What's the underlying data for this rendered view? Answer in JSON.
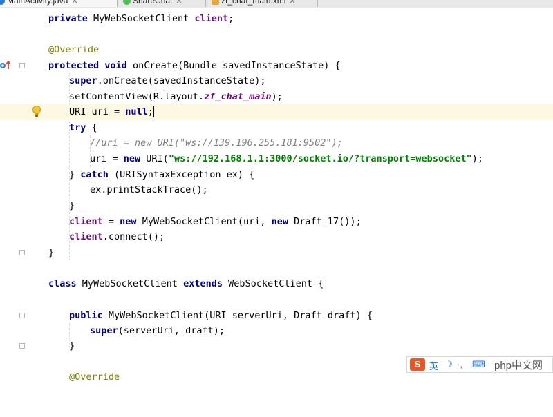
{
  "tabs": [
    {
      "label": "MainActivity.java",
      "active": true,
      "icon_color": "#2f7fc7"
    },
    {
      "label": "ShareChat",
      "active": false,
      "icon_color": "#5cb85c"
    },
    {
      "label": "zf_chat_main.xml",
      "active": false,
      "icon_color": "#e2a83b"
    }
  ],
  "code": {
    "l1": {
      "kw": "private",
      "type": " MyWebSocketClient ",
      "fld": "client",
      "end": ";"
    },
    "l3": {
      "ann": "@Override"
    },
    "l4": {
      "kw1": "protected",
      "kw2": "void",
      "rest": " onCreate(Bundle savedInstanceState) {"
    },
    "l5": {
      "kw": "super",
      "rest": ".onCreate(savedInstanceState);"
    },
    "l6": {
      "pre": "setContentView(R.layout.",
      "ital": "zf_chat_main",
      "end": ");"
    },
    "l7": {
      "pre": "URI uri = ",
      "kw": "null",
      "end": ";"
    },
    "l8": {
      "kw": "try",
      "rest": " {"
    },
    "l9": {
      "cmt": "//uri = new URI(\"ws://139.196.255.181:9502\");"
    },
    "l10": {
      "pre": "uri = ",
      "kw": "new",
      "mid": " URI(",
      "str": "\"ws://192.168.1.1:3000/socket.io/?transport=websocket\"",
      "end": ");"
    },
    "l11": {
      "pre": "} ",
      "kw": "catch",
      "rest": " (URISyntaxException ex) {"
    },
    "l12": {
      "text": "ex.printStackTrace();"
    },
    "l13": {
      "text": "}"
    },
    "l14": {
      "fld": "client",
      "pre": " = ",
      "kw1": "new",
      "mid": " MyWebSocketClient(uri, ",
      "kw2": "new",
      "end": " Draft_17());"
    },
    "l15": {
      "fld": "client",
      "end": ".connect();"
    },
    "l16": {
      "text": "}"
    },
    "l18": {
      "kw1": "class",
      "mid": " MyWebSocketClient ",
      "kw2": "extends",
      "end": " WebSocketClient {"
    },
    "l20": {
      "kw": "public",
      "rest": " MyWebSocketClient(URI serverUri, Draft draft) {"
    },
    "l21": {
      "kw": "super",
      "rest": "(serverUri, draft);"
    },
    "l22": {
      "text": "}"
    },
    "l24": {
      "ann": "@Override"
    }
  },
  "ime": {
    "lang": "英",
    "logo": "S",
    "watermark": "php中文网"
  }
}
